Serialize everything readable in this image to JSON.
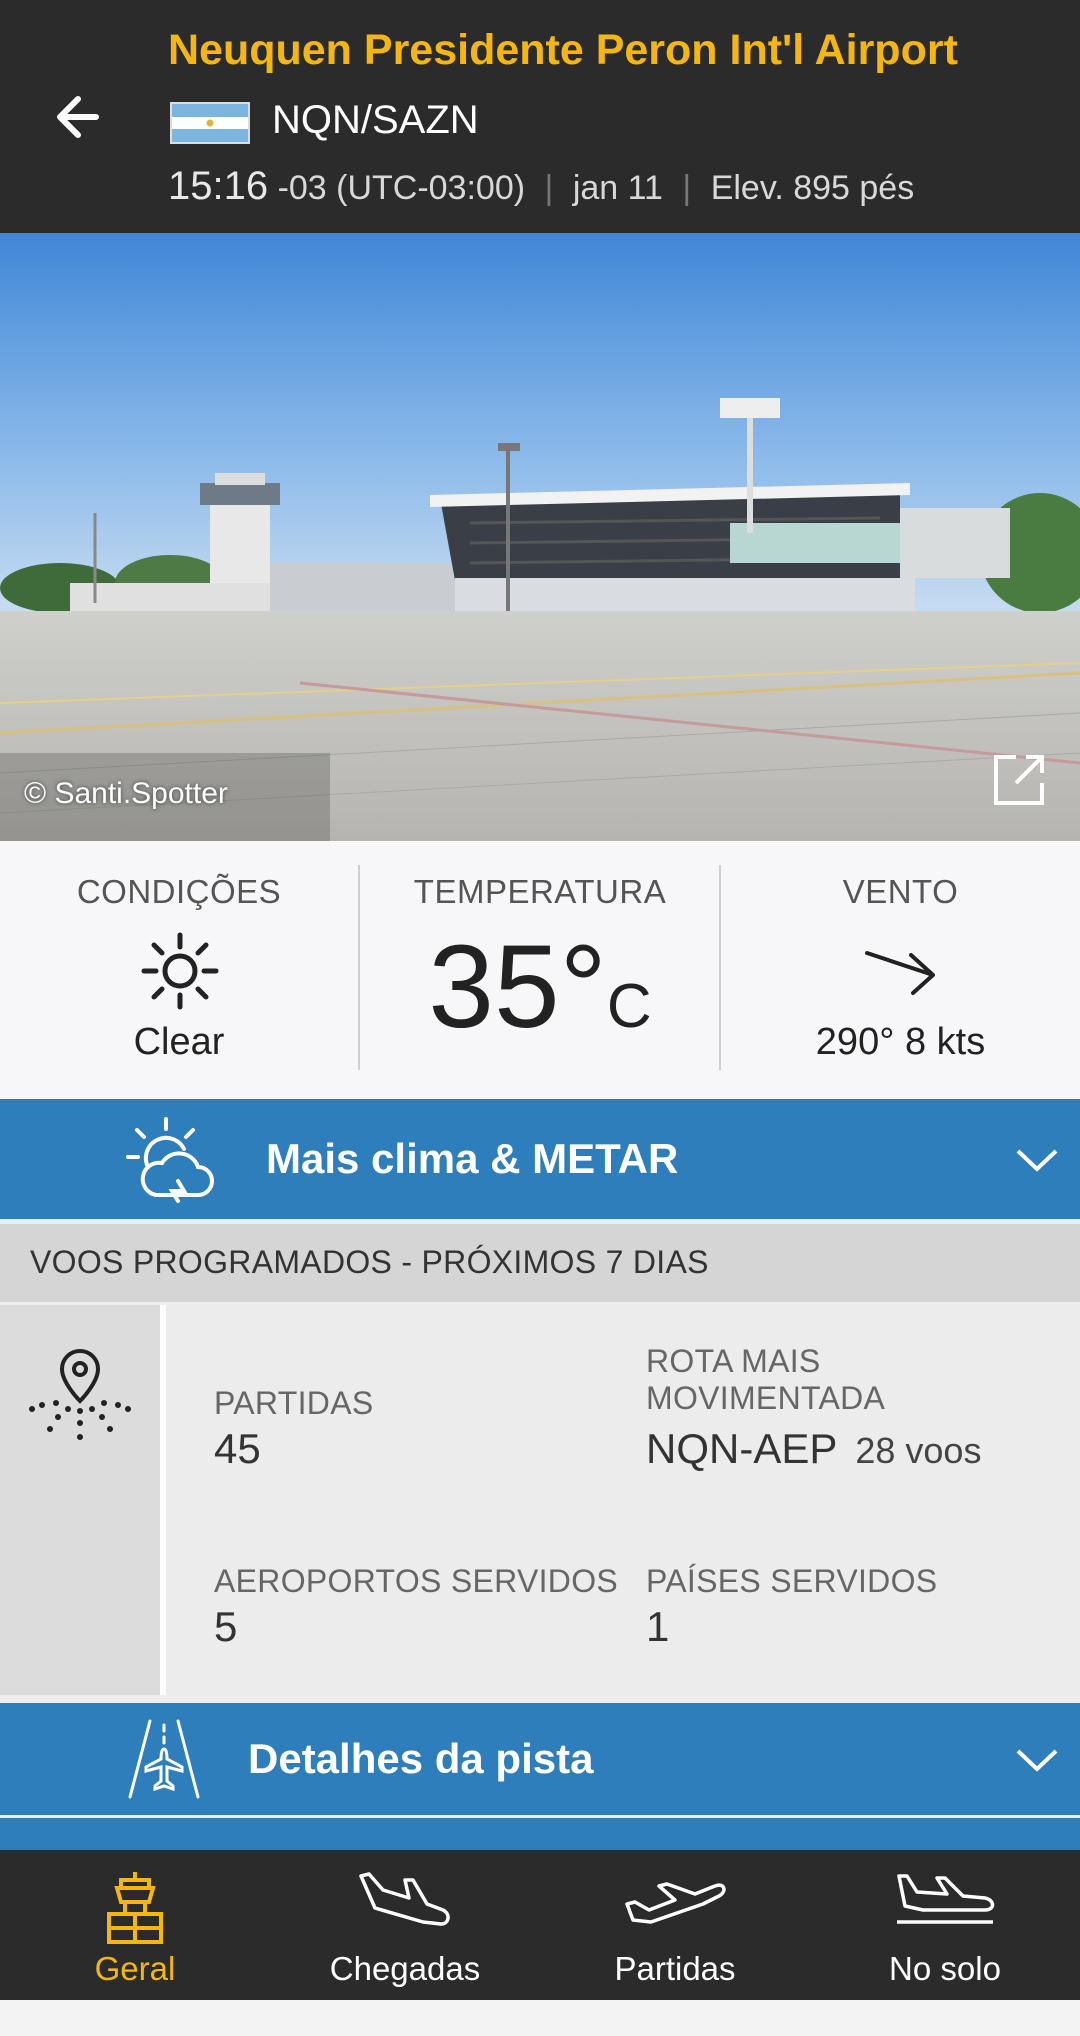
{
  "header": {
    "title": "Neuquen Presidente Peron Int'l Airport",
    "codes": "NQN/SAZN",
    "time": "15:16",
    "timezone": "-03 (UTC-03:00)",
    "date": "jan 11",
    "elevation": "Elev. 895 pés",
    "flag_icon": "argentina-flag",
    "accent_color": "#f5b70f"
  },
  "photo": {
    "credit": "© Santi.Spotter"
  },
  "conditions": {
    "conditions_label": "CONDIÇÕES",
    "conditions_value": "Clear",
    "temperature_label": "TEMPERATURA",
    "temperature_value": "35°",
    "temperature_unit": "C",
    "wind_label": "VENTO",
    "wind_value": "290° 8 kts"
  },
  "weather_bar": {
    "label": "Mais clima & METAR",
    "color": "#2e7ebb"
  },
  "scheduled": {
    "header": "VOOS PROGRAMADOS - PRÓXIMOS 7 DIAS",
    "departures_label": "PARTIDAS",
    "departures_value": "45",
    "busiest_route_label_line1": "ROTA MAIS",
    "busiest_route_label_line2": "MOVIMENTADA",
    "busiest_route_value": "NQN-AEP",
    "busiest_route_flights": "28 voos",
    "airports_served_label": "AEROPORTOS SERVIDOS",
    "airports_served_value": "5",
    "countries_served_label": "PAÍSES SERVIDOS",
    "countries_served_value": "1"
  },
  "runway_bar": {
    "label": "Detalhes da pista"
  },
  "nav": {
    "items": [
      {
        "label": "Geral",
        "icon": "control-tower-icon",
        "active": true
      },
      {
        "label": "Chegadas",
        "icon": "plane-arrival-icon",
        "active": false
      },
      {
        "label": "Partidas",
        "icon": "plane-departure-icon",
        "active": false
      },
      {
        "label": "No solo",
        "icon": "plane-ground-icon",
        "active": false
      }
    ]
  }
}
